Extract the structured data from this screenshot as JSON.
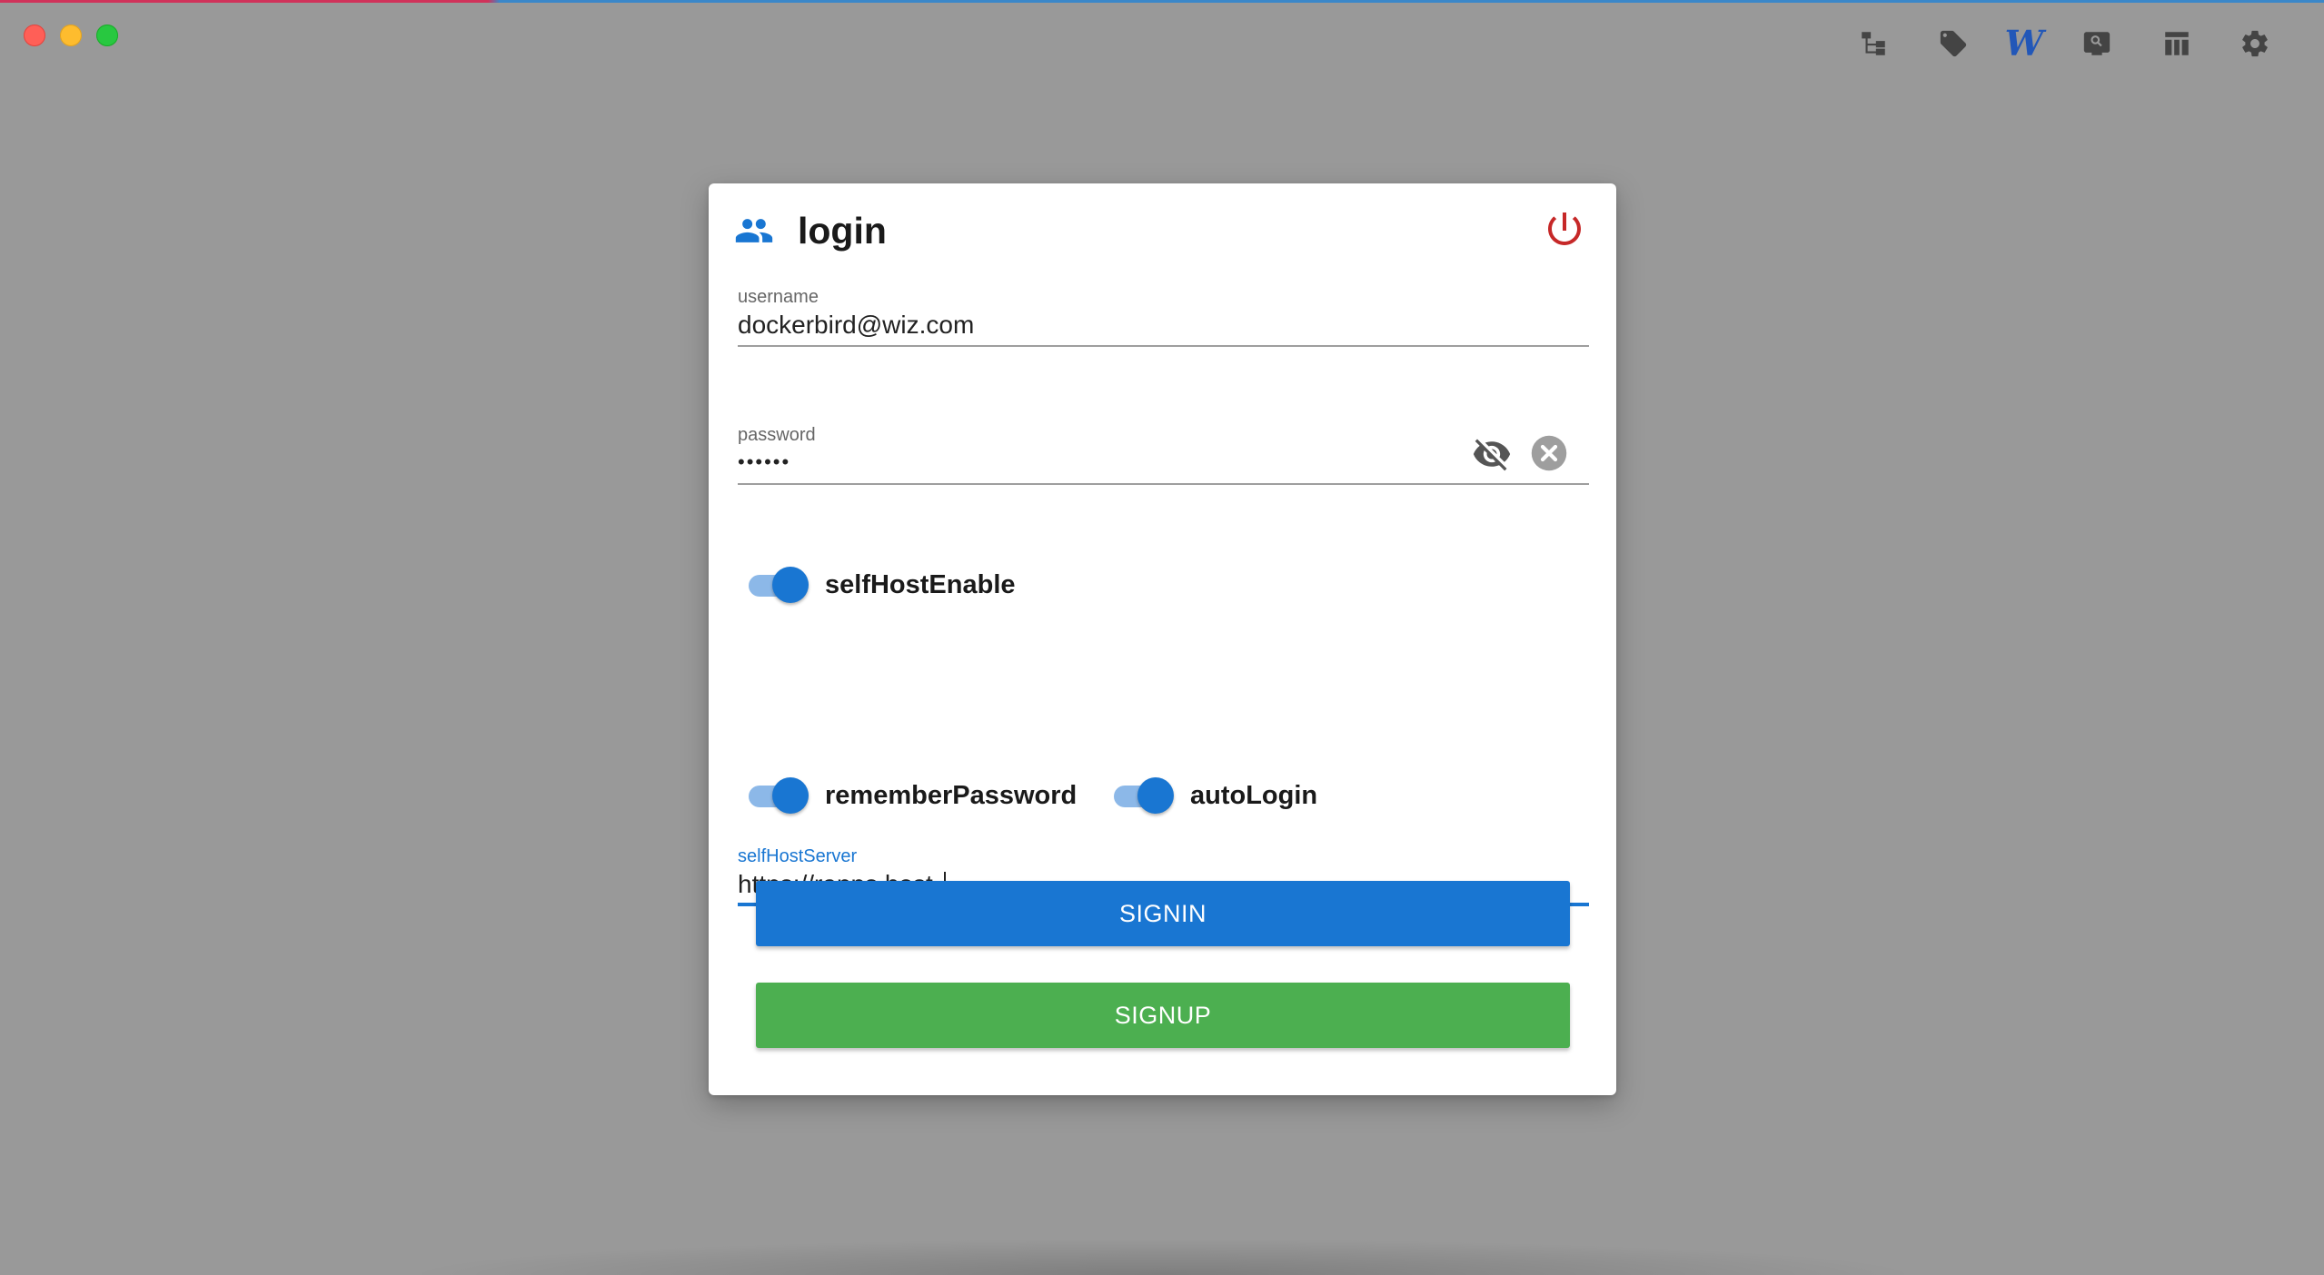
{
  "window": {
    "controls": [
      "close",
      "minimize",
      "zoom"
    ]
  },
  "toolbar": {
    "icons": [
      "sitemap-icon",
      "tag-icon",
      "wiz-logo-icon",
      "search-screen-icon",
      "table-layout-icon",
      "gear-icon"
    ],
    "logo_letter": "W"
  },
  "dialog": {
    "title": "login",
    "header_icon": "people-icon",
    "power_icon": "power-icon",
    "username": {
      "label": "username",
      "value": "dockerbird@wiz.com"
    },
    "password": {
      "label": "password",
      "value": "••••••",
      "visibility_icon": "eye-off-icon",
      "clear_icon": "clear-circle-icon"
    },
    "self_host_enable": {
      "label": "selfHostEnable",
      "checked": true
    },
    "self_host_server": {
      "label": "selfHostServer",
      "value": "https://rapps.host"
    },
    "remember_password": {
      "label": "rememberPassword",
      "checked": true
    },
    "auto_login": {
      "label": "autoLogin",
      "checked": true
    },
    "signin_label": "SIGNIN",
    "signup_label": "SIGNUP"
  },
  "colors": {
    "primary": "#1976d2",
    "success": "#4caf50",
    "danger": "#c62828",
    "backdrop": "#999999"
  }
}
